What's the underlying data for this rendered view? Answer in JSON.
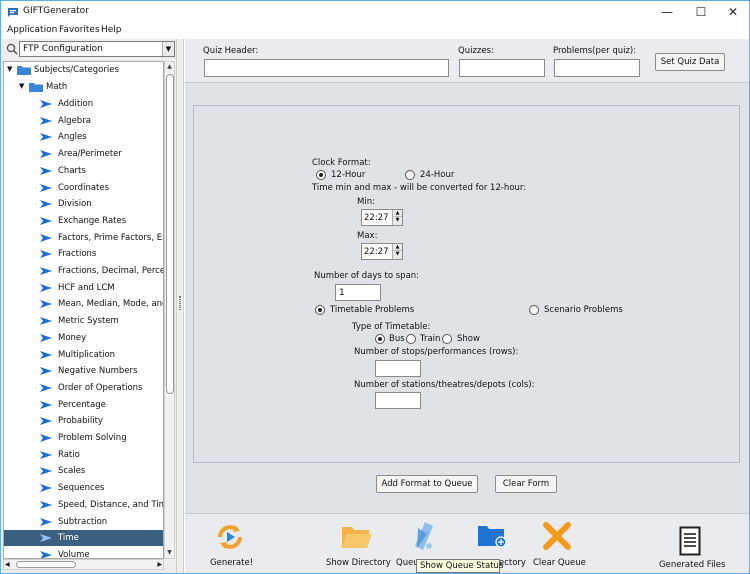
{
  "window": {
    "title": "GIFTGenerator",
    "controls": {
      "minimize": "—",
      "maximize": "☐",
      "close": "✕"
    }
  },
  "menubar": [
    {
      "label": "Application"
    },
    {
      "label": "Favorites"
    },
    {
      "label": "Help"
    }
  ],
  "left_panel": {
    "config_select": "FTP Configuration",
    "tree": {
      "root": "Subjects/Categories",
      "category": "Math",
      "leaves": [
        "Addition",
        "Algebra",
        "Angles",
        "Area/Perimeter",
        "Charts",
        "Coordinates",
        "Division",
        "Exchange Rates",
        "Factors, Prime Factors, Exp",
        "Fractions",
        "Fractions, Decimal, Percen",
        "HCF and LCM",
        "Mean, Median, Mode, and R",
        "Metric System",
        "Money",
        "Multiplication",
        "Negative Numbers",
        "Order of Operations",
        "Percentage",
        "Probability",
        "Problem Solving",
        "Ratio",
        "Scales",
        "Sequences",
        "Speed, Distance, and Time",
        "Subtraction",
        "Time",
        "Volume"
      ],
      "selected": "Time"
    }
  },
  "header": {
    "quiz_header_label": "Quiz Header:",
    "quiz_header_value": "",
    "quizzes_label": "Quizzes:",
    "quizzes_value": "",
    "problems_label": "Problems(per quiz):",
    "problems_value": "",
    "set_button": "Set Quiz Data"
  },
  "form": {
    "clock_format_label": "Clock Format:",
    "clock_options": [
      "12-Hour",
      "24-Hour"
    ],
    "clock_selected": "12-Hour",
    "time_note": "Time min and max - will be converted for 12-hour:",
    "min_label": "Min:",
    "min_value": "22:27",
    "max_label": "Max:",
    "max_value": "22:27",
    "days_label": "Number of days to span:",
    "days_value": "1",
    "problem_types": [
      "Timetable Problems",
      "Scenario Problems"
    ],
    "problem_type_selected": "Timetable Problems",
    "timetable_type_label": "Type of Timetable:",
    "timetable_types": [
      "Bus",
      "Train",
      "Show"
    ],
    "timetable_type_selected": "Bus",
    "stops_label": "Number of stops/performances (rows):",
    "stops_value": "",
    "stations_label": "Number of stations/theatres/depots (cols):",
    "stations_value": "",
    "add_button": "Add Format to Queue",
    "clear_form_button": "Clear Form"
  },
  "toolbar": {
    "generate": "Generate!",
    "show_directory": "Show Directory",
    "queue_status_partial": "Queu",
    "new_directory_partial": "ectory",
    "clear_queue": "Clear Queue",
    "generated_files": "Generated Files",
    "tooltip": "Show Queue Status"
  },
  "colors": {
    "selected_row": "#3b5f80",
    "folder_icon": "#3a87d8",
    "leaf_arrow": "#1c6fd6",
    "open_folder": "#f3b34a",
    "clear_x": "#f39a1a",
    "new_folder": "#1f73d3",
    "generate_icon": "#f2a22b",
    "generate_play": "#2f86d8"
  }
}
